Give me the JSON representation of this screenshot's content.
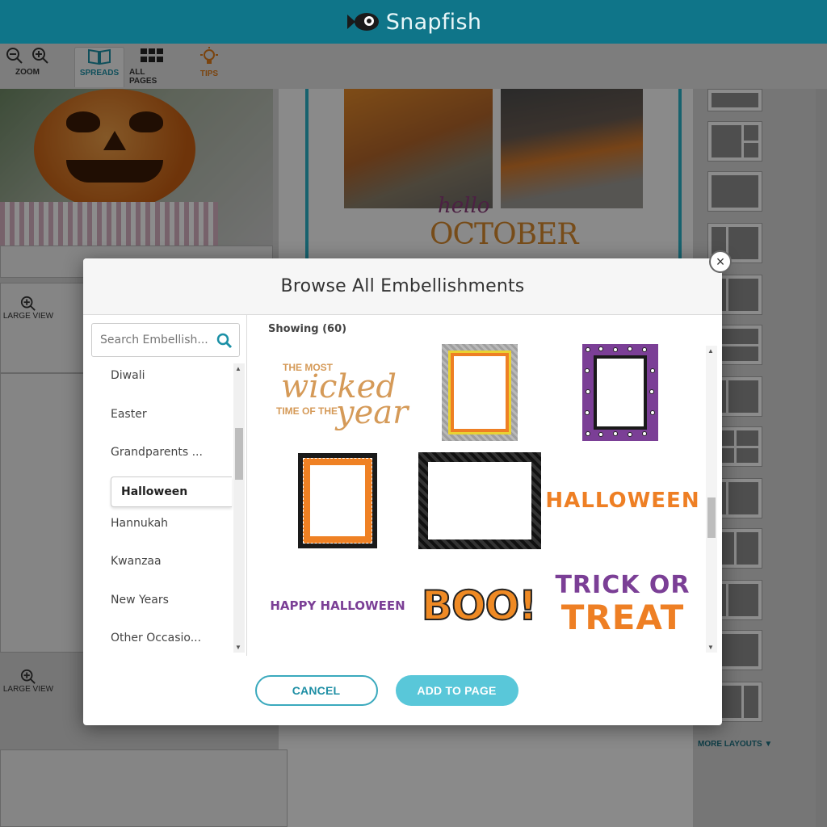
{
  "app": {
    "name": "Snapfish"
  },
  "toolbar": {
    "zoom_label": "ZOOM",
    "spreads_label": "SPREADS",
    "all_pages_label": "ALL PAGES",
    "tips_label": "TIPS"
  },
  "canvas": {
    "large_view_label": "LARGE VIEW",
    "spread_text_hello": "hello",
    "spread_text_october": "OCTOBER",
    "more_layouts_label": "MORE LAYOUTS"
  },
  "modal": {
    "title": "Browse All Embellishments",
    "close_glyph": "×",
    "search": {
      "placeholder": "Search Embellish...",
      "value": ""
    },
    "categories": [
      {
        "label": "Diwali"
      },
      {
        "label": "Easter"
      },
      {
        "label": "Grandparents ..."
      },
      {
        "label": "Halloween",
        "selected": true
      },
      {
        "label": "Hannukah"
      },
      {
        "label": "Kwanzaa"
      },
      {
        "label": "New Years"
      },
      {
        "label": "Other Occasio..."
      }
    ],
    "showing_label": "Showing (60)",
    "embellishments": [
      {
        "name": "the-most-wicked-time-of-the-year",
        "text_top": "THE MOST",
        "text_script": "wicked",
        "text_mid": "TIME OF THE",
        "text_script2": "year"
      },
      {
        "name": "orange-yellow-frame"
      },
      {
        "name": "purple-eyeball-frame"
      },
      {
        "name": "orange-black-frame"
      },
      {
        "name": "black-frame"
      },
      {
        "name": "halloween-word",
        "text": "HALLOWEEN"
      },
      {
        "name": "happy-halloween-word",
        "text": "HAPPY HALLOWEEN"
      },
      {
        "name": "boo-word",
        "text": "BOO!"
      },
      {
        "name": "trick-or-treat-word",
        "line1": "TRICK OR",
        "line2": "TREAT"
      }
    ],
    "buttons": {
      "cancel": "CANCEL",
      "add": "ADD TO PAGE"
    }
  },
  "colors": {
    "header": "#0f7589",
    "accent": "#59c7d9",
    "tips": "#e07b1a",
    "halloween_orange": "#ee7f24",
    "halloween_purple": "#7b3f96",
    "halloween_green": "#8bc34a"
  }
}
